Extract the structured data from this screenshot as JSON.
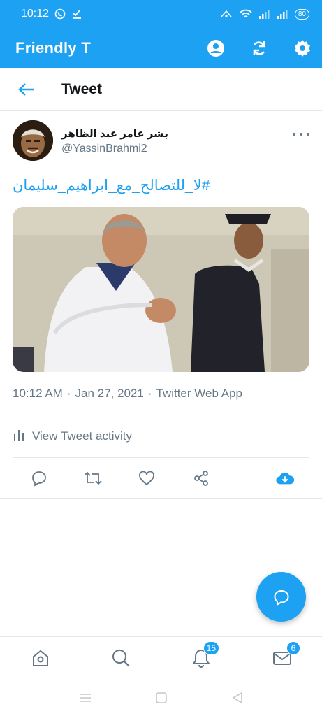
{
  "status_bar": {
    "time": "10:12",
    "battery": "80",
    "icons": [
      "whatsapp-icon",
      "download-done-icon",
      "data-icon",
      "wifi-icon",
      "signal-icon",
      "signal-icon",
      "battery-icon"
    ]
  },
  "app_bar": {
    "title": "Friendly T",
    "actions": [
      "account-icon",
      "refresh-icon",
      "settings-icon"
    ]
  },
  "sub_header": {
    "title": "Tweet"
  },
  "tweet": {
    "author_name": "بشر عامر عبد الظاهر",
    "author_handle": "@YassinBrahmi2",
    "text": "#لا_للتصالح_مع_ابراهيم_سليمان",
    "time": "10:12 AM",
    "date": "Jan 27, 2021",
    "source": "Twitter Web App",
    "separator": "·",
    "activity_label": "View Tweet activity"
  },
  "bottom_nav": {
    "items": [
      "home-icon",
      "search-icon",
      "notifications-icon",
      "messages-icon"
    ],
    "notifications_badge": "15",
    "messages_badge": "6"
  },
  "colors": {
    "brand": "#1da1f2",
    "text_secondary": "#657786",
    "divider": "#e1e8ed"
  }
}
